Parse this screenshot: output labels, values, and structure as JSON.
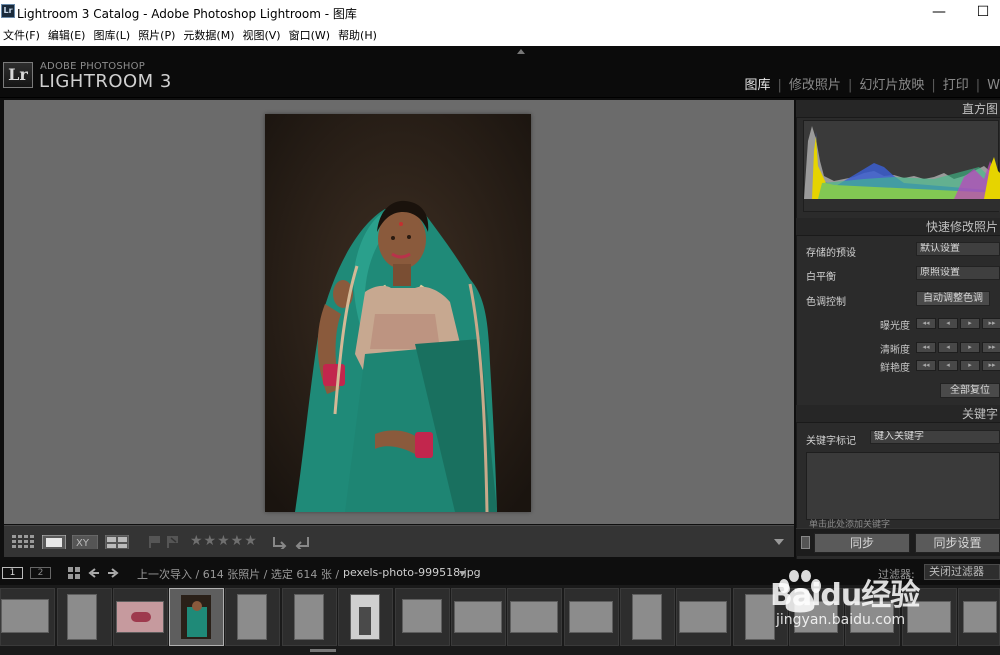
{
  "window": {
    "title": "Lightroom 3 Catalog - Adobe Photoshop Lightroom - 图库",
    "app_icon_text": "Lr"
  },
  "menubar": {
    "items": [
      "文件(F)",
      "编辑(E)",
      "图库(L)",
      "照片(P)",
      "元数据(M)",
      "视图(V)",
      "窗口(W)",
      "帮助(H)"
    ]
  },
  "identity": {
    "logo_text": "Lr",
    "brand_small": "ADOBE PHOTOSHOP",
    "brand_big": "LIGHTROOM 3"
  },
  "modules": [
    {
      "label": "图库",
      "active": true
    },
    {
      "label": "修改照片",
      "active": false
    },
    {
      "label": "幻灯片放映",
      "active": false
    },
    {
      "label": "打印",
      "active": false
    },
    {
      "label": "W",
      "active": false
    }
  ],
  "right_panel": {
    "histogram_title": "直方图",
    "quick_develop_title": "快速修改照片",
    "saved_preset_label": "存储的预设",
    "saved_preset_value": "默认设置",
    "white_balance_label": "白平衡",
    "white_balance_value": "原照设置",
    "tone_control_label": "色调控制",
    "auto_tone_label": "自动调整色调",
    "exposure_label": "曝光度",
    "clarity_label": "清晰度",
    "vibrance_label": "鲜艳度",
    "reset_all_label": "全部复位",
    "keywords_title": "关键字",
    "keyword_tags_label": "关键字标记",
    "keyword_input_placeholder": "键入关键字",
    "keyword_hint": "单击此处添加关键字",
    "sync_label": "同步",
    "sync_settings_label": "同步设置"
  },
  "filmnav": {
    "page1": "1",
    "page2": "2",
    "source_text": "上一次导入 / 614 张照片 / 选定 614 张 /",
    "filename": "pexels-photo-999518.jpg",
    "filter_label": "过滤器:",
    "filter_value": "关闭过滤器"
  },
  "toolbar": {
    "stars": "★★★★★"
  },
  "watermark": {
    "brand": "Baidu经验",
    "url": "jingyan.baidu.com"
  },
  "colors": {
    "panel_bg": "#2b2b2b",
    "main_bg": "#6b6b6b",
    "accent": "#e8e8e8"
  }
}
